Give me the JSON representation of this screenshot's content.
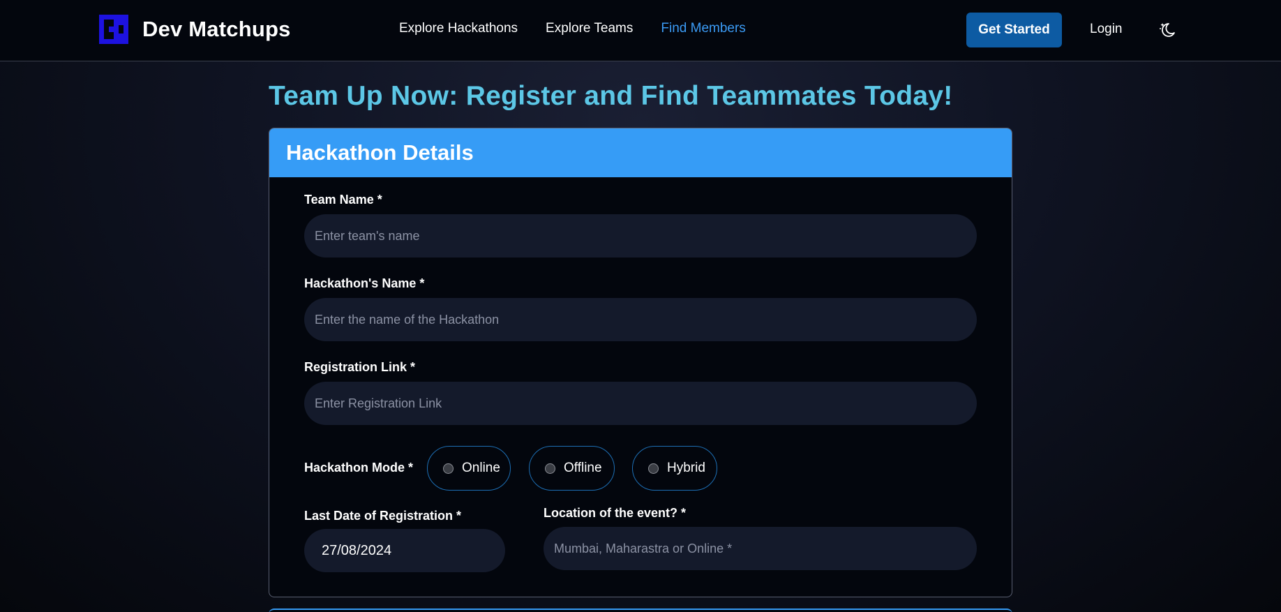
{
  "nav": {
    "brand": "Dev Matchups",
    "links": [
      "Explore Hackathons",
      "Explore Teams",
      "Find Members"
    ],
    "active_link": "Find Members",
    "cta": "Get Started",
    "login": "Login",
    "theme_icon": "moon-stars-icon"
  },
  "page": {
    "title": "Team Up Now: Register and Find Teammates Today!"
  },
  "form": {
    "section_title": "Hackathon Details",
    "team_name": {
      "label": "Team Name *",
      "placeholder": "Enter team's name",
      "value": ""
    },
    "hackathon_name": {
      "label": "Hackathon's Name *",
      "placeholder": "Enter the name of the Hackathon",
      "value": ""
    },
    "registration_link": {
      "label": "Registration Link *",
      "placeholder": "Enter Registration Link",
      "value": ""
    },
    "mode": {
      "label": "Hackathon Mode *",
      "options": [
        "Online",
        "Offline",
        "Hybrid"
      ],
      "selected": null
    },
    "last_date": {
      "label": "Last Date of Registration *",
      "value": "27/08/2024"
    },
    "location": {
      "label": "Location of the event? *",
      "placeholder": "Mumbai, Maharastra or Online *",
      "value": ""
    }
  },
  "colors": {
    "accent": "#369cf6",
    "title": "#5cc7e6",
    "cta": "#0d5ba3",
    "active_link": "#3b9bf5",
    "input_bg": "#141a2b"
  }
}
